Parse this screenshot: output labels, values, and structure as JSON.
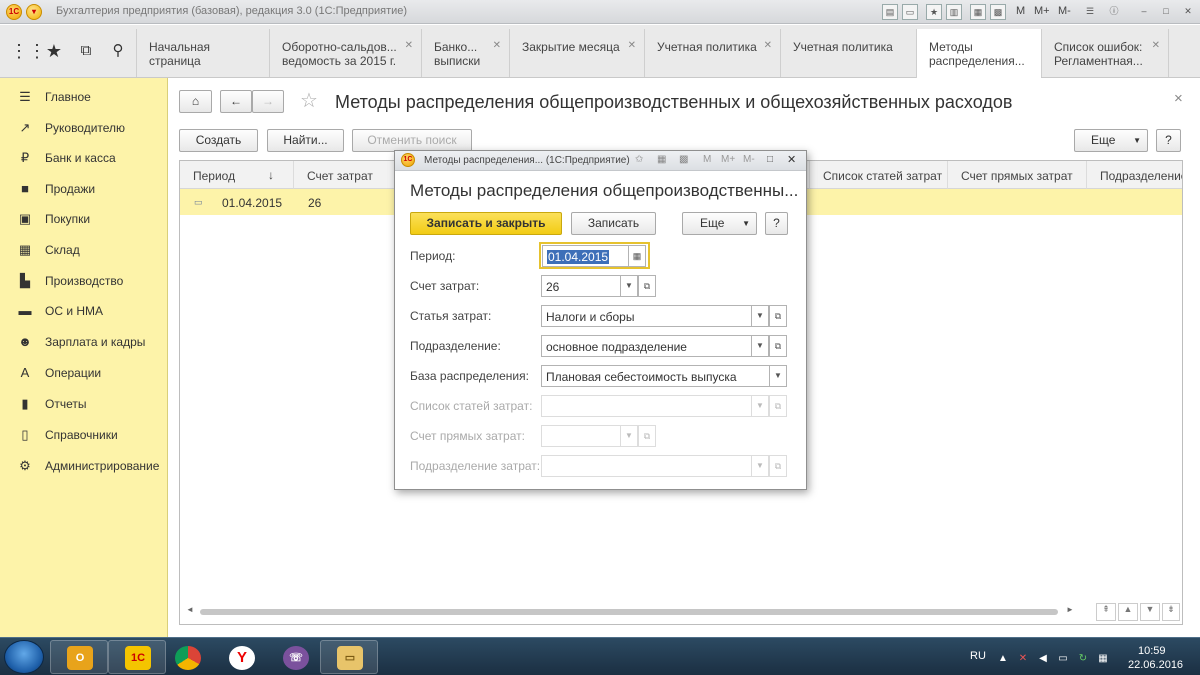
{
  "app": {
    "title": "Бухгалтерия предприятия (базовая), редакция 3.0  (1С:Предприятие)",
    "m_label": "M",
    "m_plus_label": "M+",
    "m_minus_label": "M-"
  },
  "tabs": [
    {
      "label": "Начальная страница",
      "closable": false
    },
    {
      "label": "Оборотно-сальдов... ведомость за 2015 г.",
      "closable": true
    },
    {
      "label": "Банко... выписки",
      "closable": true
    },
    {
      "label": "Закрытие месяца",
      "closable": true
    },
    {
      "label": "Учетная политика",
      "closable": true
    },
    {
      "label": "Учетная политика",
      "closable": false
    },
    {
      "label": "Методы распределения...",
      "closable": false,
      "active": true
    },
    {
      "label": "Список ошибок: Регламентная...",
      "closable": true
    }
  ],
  "sidebar": {
    "items": [
      {
        "label": "Главное",
        "icon": "list-icon"
      },
      {
        "label": "Руководителю",
        "icon": "chart-icon"
      },
      {
        "label": "Банк и касса",
        "icon": "coin-icon"
      },
      {
        "label": "Продажи",
        "icon": "bag-icon"
      },
      {
        "label": "Покупки",
        "icon": "cart-icon"
      },
      {
        "label": "Склад",
        "icon": "warehouse-icon"
      },
      {
        "label": "Производство",
        "icon": "factory-icon"
      },
      {
        "label": "ОС и НМА",
        "icon": "car-icon"
      },
      {
        "label": "Зарплата и кадры",
        "icon": "people-icon"
      },
      {
        "label": "Операции",
        "icon": "operations-icon"
      },
      {
        "label": "Отчеты",
        "icon": "report-icon"
      },
      {
        "label": "Справочники",
        "icon": "book-icon"
      },
      {
        "label": "Администрирование",
        "icon": "gear-icon"
      }
    ]
  },
  "main": {
    "title": "Методы распределения общепроизводственных и общехозяйственных расходов",
    "create_label": "Создать",
    "find_label": "Найти...",
    "cancel_search_label": "Отменить поиск",
    "more_label": "Еще",
    "help_label": "?",
    "close_label": "×",
    "columns": [
      "Период",
      "Счет затрат",
      "Список статей затрат",
      "Счет прямых затрат",
      "Подразделение"
    ],
    "sort_indicator": "↓",
    "rows": [
      {
        "period": "01.04.2015",
        "account": "26"
      }
    ]
  },
  "dialog": {
    "window_title": "Методы распределения...  (1С:Предприятие)",
    "heading": "Методы распределения общепроизводственны...",
    "save_close_label": "Записать и закрыть",
    "save_label": "Записать",
    "more_label": "Еще",
    "help_label": "?",
    "m_label": "M",
    "m_plus_label": "M+",
    "m_minus_label": "M-",
    "fields": {
      "period_label": "Период:",
      "period_value": "01.04.2015",
      "account_label": "Счет затрат:",
      "account_value": "26",
      "item_label": "Статья затрат:",
      "item_value": "Налоги и сборы",
      "division_label": "Подразделение:",
      "division_value": "основное подразделение",
      "base_label": "База распределения:",
      "base_value": "Плановая себестоимость выпуска",
      "items_list_label": "Список статей затрат:",
      "direct_account_label": "Счет прямых затрат:",
      "cost_division_label": "Подразделение затрат:"
    }
  },
  "taskbar": {
    "lang": "RU",
    "time": "10:59",
    "date": "22.06.2016",
    "apps": [
      "outlook-icon",
      "1c-icon",
      "chrome-icon",
      "yandex-icon",
      "viber-icon",
      "explorer-icon"
    ]
  },
  "colors": {
    "accent_yellow": "#fdf3a9",
    "button_yellow": "#f7d31f",
    "focus_border": "#e6c22e"
  }
}
